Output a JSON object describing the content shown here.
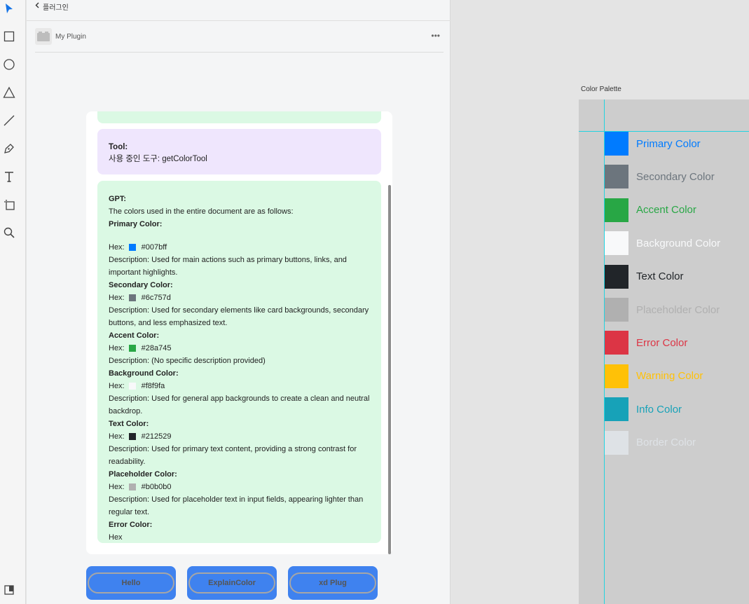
{
  "toolbar": {
    "tools": [
      "select-icon",
      "rectangle-icon",
      "ellipse-icon",
      "triangle-icon",
      "line-icon",
      "pen-icon",
      "text-icon",
      "artboard-icon",
      "zoom-icon",
      "plugins-icon"
    ]
  },
  "panel": {
    "breadcrumb": "플러그인",
    "plugin_title": "My Plugin",
    "more": "•••"
  },
  "chat": {
    "tool_msg": {
      "title": "Tool:",
      "text": "사용 중인 도구: getColorTool"
    },
    "gpt": {
      "title": "GPT:",
      "intro": "The colors used in the entire document are as follows:",
      "colors": [
        {
          "name": "Primary Color:",
          "hex_label": "Hex:",
          "hex": "#007bff",
          "desc": "Description: Used for main actions such as primary buttons, links, and important highlights."
        },
        {
          "name": "Secondary Color:",
          "hex_label": "Hex:",
          "hex": "#6c757d",
          "desc": "Description: Used for secondary elements like card backgrounds, secondary buttons, and less emphasized text."
        },
        {
          "name": "Accent Color:",
          "hex_label": "Hex:",
          "hex": "#28a745",
          "desc": "Description: (No specific description provided)"
        },
        {
          "name": "Background Color:",
          "hex_label": "Hex:",
          "hex": "#f8f9fa",
          "desc": "Description: Used for general app backgrounds to create a clean and neutral backdrop."
        },
        {
          "name": "Text Color:",
          "hex_label": "Hex:",
          "hex": "#212529",
          "desc": "Description: Used for primary text content, providing a strong contrast for readability."
        },
        {
          "name": "Placeholder Color:",
          "hex_label": "Hex:",
          "hex": "#b0b0b0",
          "desc": "Description: Used for placeholder text in input fields, appearing lighter than regular text."
        }
      ],
      "error_title": "Error Color:",
      "error_hex": "Hex"
    }
  },
  "buttons": {
    "hello": "Hello",
    "explain": "ExplainColor",
    "xd": "xd Plug"
  },
  "canvas": {
    "artboard_label": "Color Palette",
    "palette": [
      {
        "label": "Primary Color",
        "color": "#007bff",
        "text_color": "#007bff"
      },
      {
        "label": "Secondary Color",
        "color": "#6c757d",
        "text_color": "#6c757d"
      },
      {
        "label": "Accent Color",
        "color": "#28a745",
        "text_color": "#28a745"
      },
      {
        "label": "Background Color",
        "color": "#f8f9fa",
        "text_color": "#f8f9fa"
      },
      {
        "label": "Text Color",
        "color": "#212529",
        "text_color": "#212529"
      },
      {
        "label": "Placeholder Color",
        "color": "#b0b0b0",
        "text_color": "#b0b0b0"
      },
      {
        "label": "Error Color",
        "color": "#dc3545",
        "text_color": "#dc3545"
      },
      {
        "label": "Warning Color",
        "color": "#ffc107",
        "text_color": "#ffc107"
      },
      {
        "label": "Info Color",
        "color": "#17a2b8",
        "text_color": "#17a2b8"
      },
      {
        "label": "Border Color",
        "color": "#dee2e6",
        "text_color": "#dee2e6"
      }
    ]
  }
}
